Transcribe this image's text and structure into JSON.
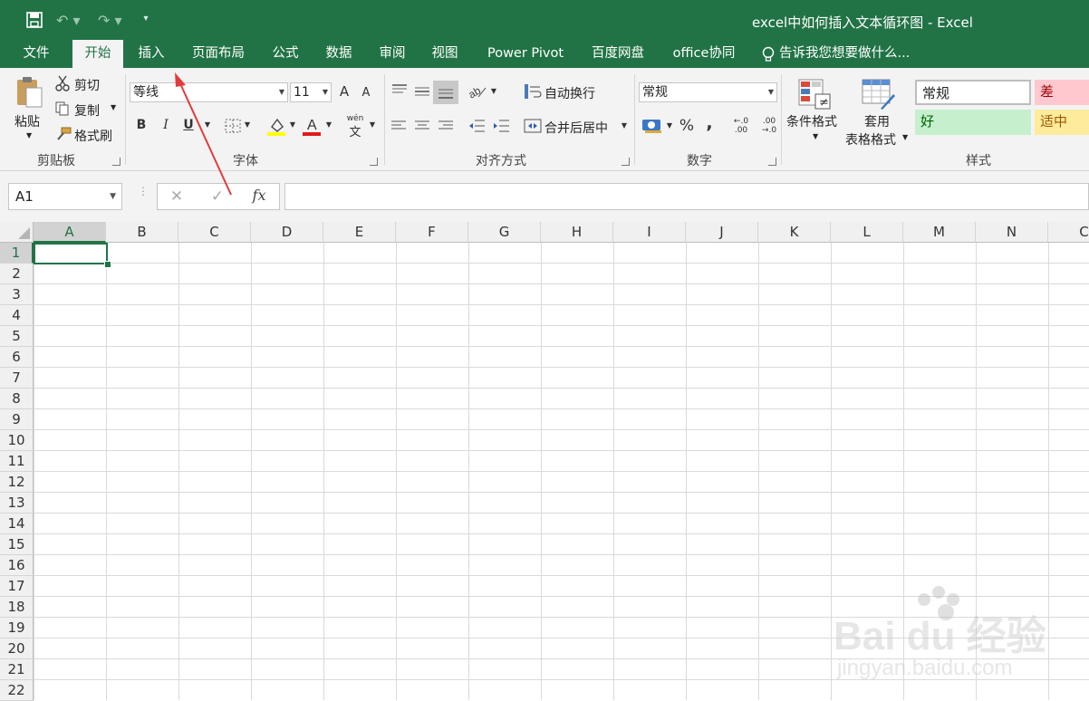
{
  "window": {
    "title": "excel中如何插入文本循环图 - Excel"
  },
  "qat": {
    "undo": "↶ ▾",
    "redo": "↷ ▾",
    "customize": "▾"
  },
  "tabs": [
    {
      "label": "文件"
    },
    {
      "label": "开始"
    },
    {
      "label": "插入"
    },
    {
      "label": "页面布局"
    },
    {
      "label": "公式"
    },
    {
      "label": "数据"
    },
    {
      "label": "审阅"
    },
    {
      "label": "视图"
    },
    {
      "label": "Power Pivot"
    },
    {
      "label": "百度网盘"
    },
    {
      "label": "office协同"
    }
  ],
  "tell_me": "告诉我您想要做什么...",
  "clipboard": {
    "paste": "粘贴",
    "cut": "剪切",
    "copy": "复制",
    "format_painter": "格式刷",
    "group": "剪贴板"
  },
  "font": {
    "name": "等线",
    "size": "11",
    "grow": "A",
    "shrink": "A",
    "bold": "B",
    "italic": "I",
    "underline": "U",
    "phonetic_top": "wén",
    "phonetic_bottom": "文",
    "group": "字体"
  },
  "alignment": {
    "wrap_text": "自动换行",
    "merge_center": "合并后居中",
    "group": "对齐方式"
  },
  "number": {
    "format": "常规",
    "percent": "%",
    "comma": ",",
    "inc_decimal": "←.0 .00",
    "dec_decimal": ".00 →.0",
    "group": "数字"
  },
  "styles": {
    "conditional_formatting": "条件格式",
    "format_as_table_1": "套用",
    "format_as_table_2": "表格格式",
    "normal": "常规",
    "bad": "差",
    "good": "好",
    "neutral": "适中",
    "group": "样式"
  },
  "name_box": "A1",
  "formula_bar": {
    "cancel": "✕",
    "enter": "✓",
    "fx": "fx"
  },
  "columns": [
    "A",
    "B",
    "C",
    "D",
    "E",
    "F",
    "G",
    "H",
    "I",
    "J",
    "K",
    "L",
    "M",
    "N",
    "C"
  ],
  "rows": [
    "1",
    "2",
    "3",
    "4",
    "5",
    "6",
    "7",
    "8",
    "9",
    "10",
    "11",
    "12",
    "13",
    "14",
    "15",
    "16",
    "17",
    "18",
    "19",
    "20",
    "21",
    "22"
  ],
  "watermark": {
    "brand": "Bai du 经验",
    "url": "jingyan.baidu.com"
  },
  "colors": {
    "accent": "#217346",
    "ribbon_bg": "#f3f3f3",
    "bad_bg": "#ffc7ce",
    "good_bg": "#c6efce",
    "neutral_bg": "#ffeb9c",
    "arrow": "#e23b3b"
  }
}
